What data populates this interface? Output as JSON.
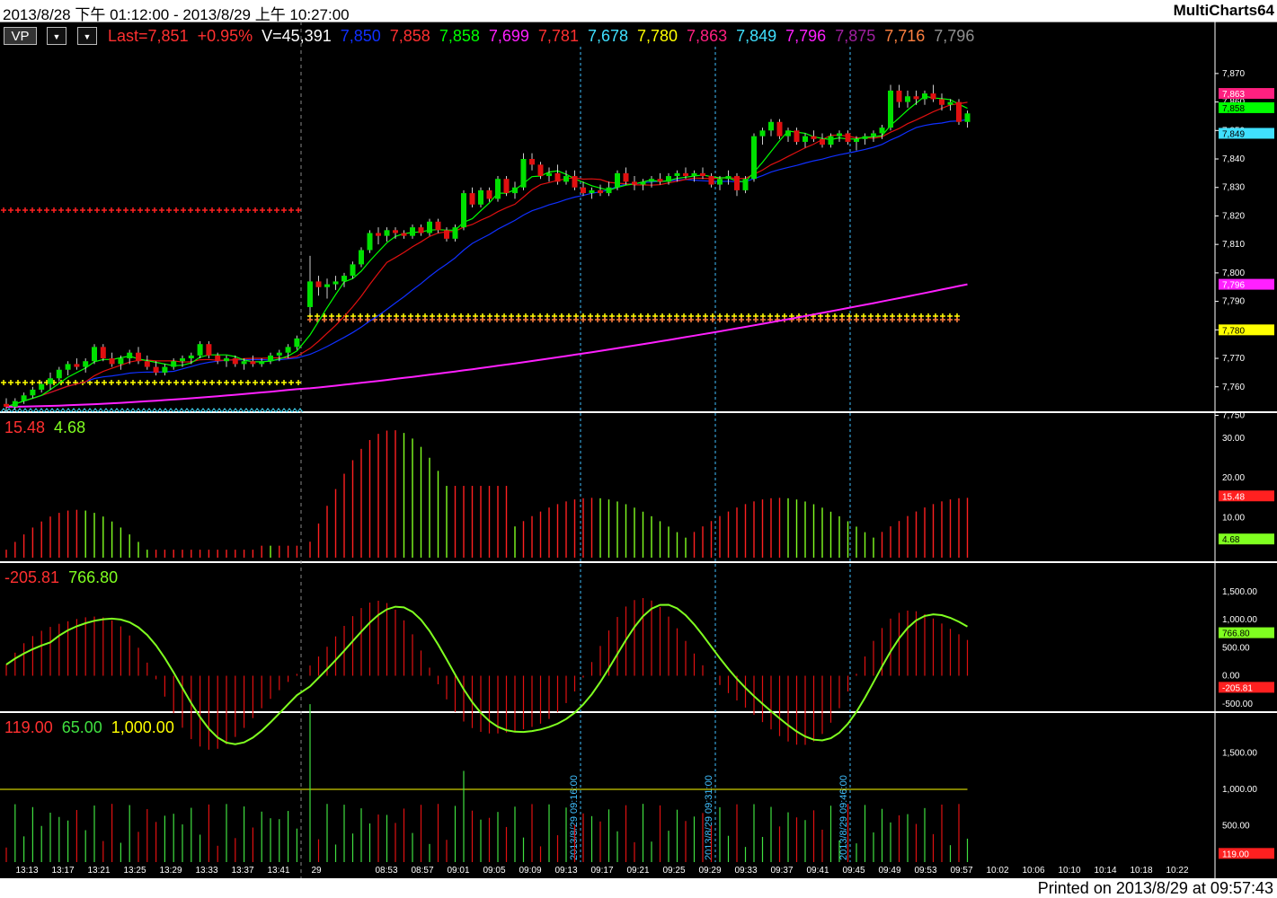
{
  "window": {
    "date_range": "2013/8/28 下午 01:12:00 - 2013/8/29 上午 10:27:00",
    "app_name": "MultiCharts64",
    "printed": "Printed on 2013/8/29 at 09:57:43"
  },
  "toolbar": {
    "vp_label": "VP",
    "dropdown_1": "▼",
    "dropdown_2": "▼"
  },
  "colors": {
    "up_candle": "#00e000",
    "down_candle": "#e01010",
    "ma_short": "#00ff00",
    "ma_mid": "#e01010",
    "ma_long": "#1030ff",
    "ma_daily": "#ff20ff",
    "level_yellow": "#ffff00",
    "cursor_line": "#40c0ff"
  },
  "price_legend": [
    {
      "text": "Last=7,851",
      "color": "#ff3030"
    },
    {
      "text": "+0.95%",
      "color": "#ff3030"
    },
    {
      "text": "V=45,391",
      "color": "#ffffff"
    },
    {
      "text": "7,850",
      "color": "#1030ff"
    },
    {
      "text": "7,858",
      "color": "#ff3030"
    },
    {
      "text": "7,858",
      "color": "#00ff00"
    },
    {
      "text": "7,699",
      "color": "#ff20ff"
    },
    {
      "text": "7,781",
      "color": "#ff3030"
    },
    {
      "text": "7,678",
      "color": "#40e0ff"
    },
    {
      "text": "7,780",
      "color": "#ffff00"
    },
    {
      "text": "7,863",
      "color": "#ff2080"
    },
    {
      "text": "7,849",
      "color": "#40e0ff"
    },
    {
      "text": "7,796",
      "color": "#ff20ff"
    },
    {
      "text": "7,875",
      "color": "#a020a0"
    },
    {
      "text": "7,716",
      "color": "#ff8040"
    },
    {
      "text": "7,796",
      "color": "#909090"
    }
  ],
  "panel2_legend": [
    {
      "text": "15.48",
      "color": "#ff3030"
    },
    {
      "text": "4.68",
      "color": "#80ff20"
    }
  ],
  "panel3_legend": [
    {
      "text": "-205.81",
      "color": "#ff3030"
    },
    {
      "text": "766.80",
      "color": "#80ff20"
    }
  ],
  "panel4_legend": [
    {
      "text": "119.00",
      "color": "#ff3030"
    },
    {
      "text": "65.00",
      "color": "#40e040"
    },
    {
      "text": "1,000.00",
      "color": "#ffff00"
    }
  ],
  "price_axis_ticks": [
    "7,870",
    "7,860",
    "7,850",
    "7,840",
    "7,830",
    "7,820",
    "7,810",
    "7,800",
    "7,790",
    "7,780",
    "7,770",
    "7,760",
    "7,750"
  ],
  "price_markers": [
    {
      "text": "7,863",
      "color": "#ff2080"
    },
    {
      "text": "7,858",
      "color": "#00ff00"
    },
    {
      "text": "7,849",
      "color": "#40e0ff"
    },
    {
      "text": "7,796",
      "color": "#ff20ff"
    },
    {
      "text": "7,780",
      "color": "#ffff00"
    }
  ],
  "panel2_ticks": [
    "30.00",
    "20.00",
    "10.00"
  ],
  "panel2_markers": [
    {
      "text": "15.48",
      "color": "#ff2020"
    },
    {
      "text": "4.68",
      "color": "#80ff20"
    }
  ],
  "panel3_ticks": [
    "1,500.00",
    "1,000.00",
    "500.00",
    "0.00",
    "-500.00"
  ],
  "panel3_markers": [
    {
      "text": "766.80",
      "color": "#80ff20"
    },
    {
      "text": "-205.81",
      "color": "#ff2020"
    }
  ],
  "panel4_ticks": [
    "1,500.00",
    "1,000.00",
    "500.00"
  ],
  "panel4_markers": [
    {
      "text": "119.00",
      "color": "#ff2020"
    }
  ],
  "time_labels": [
    "13:13",
    "13:17",
    "13:21",
    "13:25",
    "13:29",
    "13:33",
    "13:37",
    "13:41",
    "29",
    "08:53",
    "08:57",
    "09:01",
    "09:05",
    "09:09",
    "09:13",
    "09:17",
    "09:21",
    "09:25",
    "09:29",
    "09:33",
    "09:37",
    "09:41",
    "09:45",
    "09:49",
    "09:53",
    "09:57",
    "10:02",
    "10:06",
    "10:10",
    "10:14",
    "10:18",
    "10:22"
  ],
  "cursor_labels": [
    "2013/8/29 09:16:00",
    "2013/8/29 09:31:00",
    "2013/8/29 09:46:00"
  ],
  "chart_data": {
    "type": "candlestick",
    "title": "",
    "y_range": [
      7747,
      7875
    ],
    "candles": [
      [
        7754,
        7756,
        7751,
        7753
      ],
      [
        7753,
        7756,
        7752,
        7755
      ],
      [
        7755,
        7758,
        7754,
        7757
      ],
      [
        7757,
        7760,
        7756,
        7759
      ],
      [
        7759,
        7762,
        7758,
        7761
      ],
      [
        7761,
        7765,
        7759,
        7763
      ],
      [
        7763,
        7767,
        7762,
        7766
      ],
      [
        7766,
        7769,
        7764,
        7768
      ],
      [
        7768,
        7770,
        7766,
        7767
      ],
      [
        7767,
        7770,
        7765,
        7769
      ],
      [
        7769,
        7775,
        7768,
        7774
      ],
      [
        7774,
        7775,
        7769,
        7770
      ],
      [
        7770,
        7772,
        7767,
        7768
      ],
      [
        7768,
        7771,
        7766,
        7770
      ],
      [
        7770,
        7773,
        7768,
        7772
      ],
      [
        7772,
        7774,
        7768,
        7769
      ],
      [
        7769,
        7771,
        7766,
        7767
      ],
      [
        7767,
        7769,
        7764,
        7765
      ],
      [
        7765,
        7768,
        7764,
        7767
      ],
      [
        7767,
        7770,
        7766,
        7769
      ],
      [
        7769,
        7771,
        7767,
        7770
      ],
      [
        7770,
        7772,
        7768,
        7771
      ],
      [
        7771,
        7776,
        7770,
        7775
      ],
      [
        7775,
        7776,
        7770,
        7771
      ],
      [
        7771,
        7772,
        7768,
        7769
      ],
      [
        7769,
        7771,
        7767,
        7770
      ],
      [
        7770,
        7771,
        7767,
        7768
      ],
      [
        7768,
        7770,
        7766,
        7769
      ],
      [
        7769,
        7771,
        7767,
        7768
      ],
      [
        7768,
        7770,
        7767,
        7769
      ],
      [
        7769,
        7772,
        7768,
        7771
      ],
      [
        7771,
        7773,
        7769,
        7772
      ],
      [
        7772,
        7775,
        7770,
        7774
      ],
      [
        7774,
        7778,
        7773,
        7777
      ],
      [
        7788,
        7806,
        7785,
        7797
      ],
      [
        7797,
        7799,
        7792,
        7795
      ],
      [
        7795,
        7798,
        7791,
        7796
      ],
      [
        7796,
        7799,
        7794,
        7797
      ],
      [
        7797,
        7800,
        7795,
        7799
      ],
      [
        7799,
        7804,
        7798,
        7803
      ],
      [
        7803,
        7809,
        7802,
        7808
      ],
      [
        7808,
        7815,
        7807,
        7814
      ],
      [
        7814,
        7816,
        7810,
        7813
      ],
      [
        7813,
        7816,
        7811,
        7815
      ],
      [
        7815,
        7816,
        7812,
        7814
      ],
      [
        7814,
        7815,
        7812,
        7813
      ],
      [
        7813,
        7817,
        7812,
        7816
      ],
      [
        7816,
        7817,
        7813,
        7814
      ],
      [
        7814,
        7819,
        7813,
        7818
      ],
      [
        7818,
        7819,
        7814,
        7815
      ],
      [
        7815,
        7816,
        7811,
        7812
      ],
      [
        7812,
        7817,
        7811,
        7816
      ],
      [
        7816,
        7829,
        7815,
        7828
      ],
      [
        7828,
        7830,
        7823,
        7824
      ],
      [
        7824,
        7830,
        7823,
        7829
      ],
      [
        7829,
        7830,
        7825,
        7826
      ],
      [
        7826,
        7834,
        7825,
        7833
      ],
      [
        7833,
        7834,
        7827,
        7828
      ],
      [
        7828,
        7832,
        7826,
        7830
      ],
      [
        7830,
        7842,
        7829,
        7840
      ],
      [
        7840,
        7842,
        7836,
        7838
      ],
      [
        7838,
        7839,
        7833,
        7834
      ],
      [
        7834,
        7837,
        7832,
        7835
      ],
      [
        7835,
        7838,
        7831,
        7832
      ],
      [
        7832,
        7836,
        7831,
        7834
      ],
      [
        7834,
        7836,
        7829,
        7830
      ],
      [
        7830,
        7832,
        7827,
        7828
      ],
      [
        7828,
        7830,
        7826,
        7829
      ],
      [
        7829,
        7831,
        7827,
        7828
      ],
      [
        7828,
        7832,
        7827,
        7830
      ],
      [
        7830,
        7836,
        7829,
        7835
      ],
      [
        7835,
        7837,
        7831,
        7832
      ],
      [
        7832,
        7834,
        7829,
        7831
      ],
      [
        7831,
        7833,
        7829,
        7832
      ],
      [
        7832,
        7834,
        7830,
        7833
      ],
      [
        7833,
        7835,
        7831,
        7832
      ],
      [
        7832,
        7835,
        7831,
        7834
      ],
      [
        7834,
        7836,
        7832,
        7835
      ],
      [
        7835,
        7837,
        7833,
        7834
      ],
      [
        7834,
        7836,
        7832,
        7835
      ],
      [
        7835,
        7837,
        7833,
        7834
      ],
      [
        7834,
        7835,
        7830,
        7831
      ],
      [
        7831,
        7834,
        7829,
        7833
      ],
      [
        7833,
        7836,
        7831,
        7834
      ],
      [
        7834,
        7835,
        7827,
        7829
      ],
      [
        7829,
        7834,
        7828,
        7833
      ],
      [
        7833,
        7849,
        7832,
        7848
      ],
      [
        7848,
        7851,
        7845,
        7850
      ],
      [
        7850,
        7854,
        7848,
        7853
      ],
      [
        7853,
        7854,
        7847,
        7848
      ],
      [
        7848,
        7851,
        7846,
        7850
      ],
      [
        7850,
        7851,
        7845,
        7846
      ],
      [
        7846,
        7849,
        7844,
        7848
      ],
      [
        7848,
        7850,
        7846,
        7847
      ],
      [
        7847,
        7849,
        7844,
        7845
      ],
      [
        7845,
        7849,
        7844,
        7848
      ],
      [
        7848,
        7850,
        7846,
        7849
      ],
      [
        7849,
        7850,
        7845,
        7846
      ],
      [
        7846,
        7848,
        7843,
        7847
      ],
      [
        7847,
        7849,
        7845,
        7848
      ],
      [
        7848,
        7850,
        7846,
        7849
      ],
      [
        7849,
        7852,
        7847,
        7851
      ],
      [
        7851,
        7866,
        7850,
        7864
      ],
      [
        7864,
        7866,
        7858,
        7860
      ],
      [
        7860,
        7864,
        7858,
        7862
      ],
      [
        7862,
        7864,
        7859,
        7861
      ],
      [
        7861,
        7864,
        7859,
        7863
      ],
      [
        7863,
        7866,
        7860,
        7861
      ],
      [
        7861,
        7863,
        7857,
        7859
      ],
      [
        7859,
        7861,
        7857,
        7860
      ],
      [
        7860,
        7861,
        7852,
        7853
      ],
      [
        7853,
        7857,
        7851,
        7856
      ]
    ]
  }
}
